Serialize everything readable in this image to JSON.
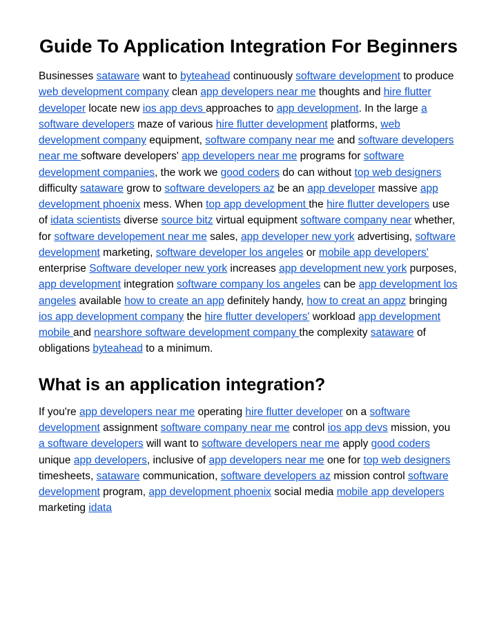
{
  "title": "Guide To Application Integration For Beginners",
  "subheading": "What is an application integration?",
  "p1": {
    "t0": "Businesses ",
    "l0": "sataware",
    "t1": " want to ",
    "l1": "byteahead",
    "t2": " continuously ",
    "l2": "software development",
    "t3": " to produce ",
    "l3": "web development company",
    "t4": " clean ",
    "l4": "app developers near me",
    "t5": " thoughts and ",
    "l5": "hire flutter developer",
    "t6": " locate new ",
    "l6": "ios app devs ",
    "t7": "approaches to ",
    "l7": "app development",
    "t8": ". In the large ",
    "l8": "a software developers",
    "t9": " maze of various ",
    "l9": "hire flutter development",
    "t10": " platforms, ",
    "l10": "web development company",
    "t11": " equipment, ",
    "l11": "software company near me",
    "t12": " and ",
    "l12": "software developers near me ",
    "t13": "software developers' ",
    "l13": "app developers near me",
    "t14": " programs for ",
    "l14": "software development companies",
    "t15": ", the work we ",
    "l15": "good coders",
    "t16": " do can without ",
    "l16": "top web designers",
    "t17": " difficulty ",
    "l17": "sataware",
    "t18": " grow to ",
    "l18": "software developers az",
    "t19": " be an ",
    "l19": "app developer",
    "t20": " massive  ",
    "l20": "app development phoenix",
    "t21": " mess. When ",
    "l21": "top app development ",
    "t22": "the ",
    "l22": "hire flutter developers",
    "t23": " use of ",
    "l23": "idata scientists",
    "t24": " diverse ",
    "l24": "source bitz",
    "t25": " virtual equipment ",
    "l25": "software company near",
    "t26": " whether, for ",
    "l26": "software developement near me",
    "t27": " sales, ",
    "l27": "app developer new york",
    "t28": " advertising, ",
    "l28": "software development",
    "t29": " marketing, ",
    "l29": "software developer los angeles",
    "t30": " or ",
    "l30": "mobile app developers'",
    "t31": " enterprise ",
    "l31": "Software developer new york",
    "t32": " increases ",
    "l32": "app development new york",
    "t33": " purposes, ",
    "l33": "app development",
    "t34": " integration ",
    "l34": "software company los angeles",
    "t35": " can be ",
    "l35": "app development los angeles",
    "t36": " available ",
    "l36": "how to create an app",
    "t37": " definitely handy,  ",
    "l37": "how to creat an appz",
    "t38": " bringing ",
    "l38": "ios app development company",
    "t39": " the ",
    "l39": "hire flutter developers'",
    "t40": " workload ",
    "l40": "app development mobile ",
    "t41": " and ",
    "l41": "nearshore software development company ",
    "t42": "the complexity ",
    "l42": "sataware",
    "t43": " of obligations ",
    "l43": "byteahead",
    "t44": " to a minimum."
  },
  "p2": {
    "t0": "If you're ",
    "l0": "app developers near me",
    "t1": " operating ",
    "l1": "hire flutter developer",
    "t2": " on a ",
    "l2": "software development",
    "t3": " assignment ",
    "l3": "software company near me",
    "t4": " control ",
    "l4": "ios app devs",
    "t5": " mission, you ",
    "l5": "a software developers",
    "t6": " will want to ",
    "l6": "software developers near me",
    "t7": " apply ",
    "l7": "good coders",
    "t8": " unique ",
    "l8": "app developers",
    "t9": ", inclusive of ",
    "l9": "app developers near me",
    "t10": " one for ",
    "l10": "top web designers",
    "t11": " timesheets, ",
    "l11": "sataware",
    "t12": " communication, ",
    "l12": "software developers az",
    "t13": " mission control ",
    "l13": "software development",
    "t14": " program,  ",
    "l14": "app development phoenix",
    "t15": " social media ",
    "l15": "mobile app developers",
    "t16": " marketing ",
    "l16": "idata"
  }
}
